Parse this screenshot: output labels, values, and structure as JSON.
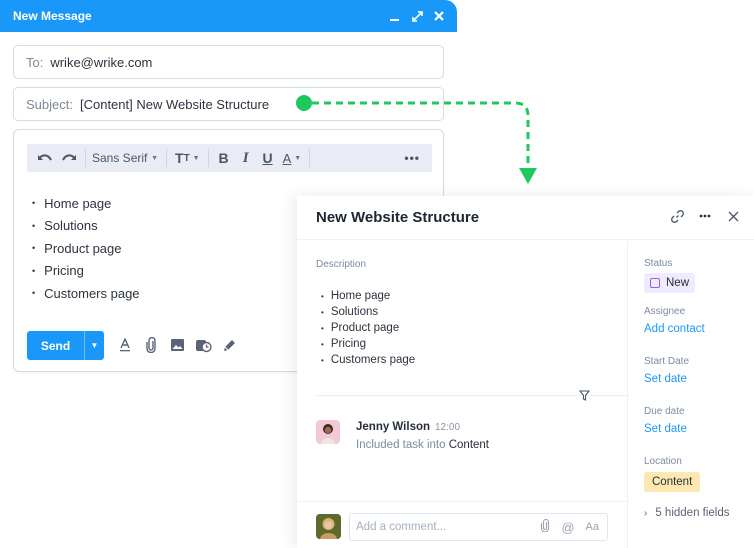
{
  "compose": {
    "title": "New Message",
    "window_controls": [
      "minimize-icon",
      "expand-icon",
      "close-icon"
    ],
    "to_label": "To:",
    "to_value": "wrike@wrike.com",
    "subject_label": "Subject:",
    "subject_value": "[Content] New Website Structure",
    "toolbar": {
      "font": "Sans Serif",
      "buttons": [
        "undo-icon",
        "redo-icon",
        "font-select",
        "text-size-icon",
        "bold-icon",
        "italic-icon",
        "underline-icon",
        "text-color-icon",
        "more-icon"
      ],
      "bold": "B",
      "italic": "I",
      "underline": "U",
      "color": "A",
      "more": "•••"
    },
    "body_items": [
      "Home page",
      "Solutions",
      "Product page",
      "Pricing",
      "Customers page"
    ],
    "send_label": "Send",
    "footer_tools": [
      "format-text-icon",
      "attach-icon",
      "image-icon",
      "schedule-icon",
      "signature-icon"
    ]
  },
  "connector": {
    "color": "#1ec760"
  },
  "task": {
    "title": "New Website Structure",
    "header_actions": [
      "link-icon",
      "more-icon",
      "close-icon"
    ],
    "description_label": "Description",
    "description_items": [
      "Home page",
      "Solutions",
      "Product page",
      "Pricing",
      "Customers page"
    ],
    "activity": {
      "name": "Jenny Wilson",
      "time": "12:00",
      "text": "Included task into",
      "target": "Content"
    },
    "comment_placeholder": "Add a comment...",
    "comment_tools": {
      "attach": "attach-icon",
      "mention": "@",
      "format": "Aa"
    },
    "side": {
      "status_label": "Status",
      "status_value": "New",
      "assignee_label": "Assignee",
      "assignee_value": "Add contact",
      "start_label": "Start Date",
      "start_value": "Set date",
      "due_label": "Due date",
      "due_value": "Set date",
      "location_label": "Location",
      "location_value": "Content",
      "hidden_fields": "5 hidden fields"
    }
  },
  "colors": {
    "accent": "#1a98fa",
    "status_chip": "#efeafd",
    "status_border": "#8d62e3",
    "location_chip": "#fde9b0",
    "connector": "#1ec760"
  }
}
